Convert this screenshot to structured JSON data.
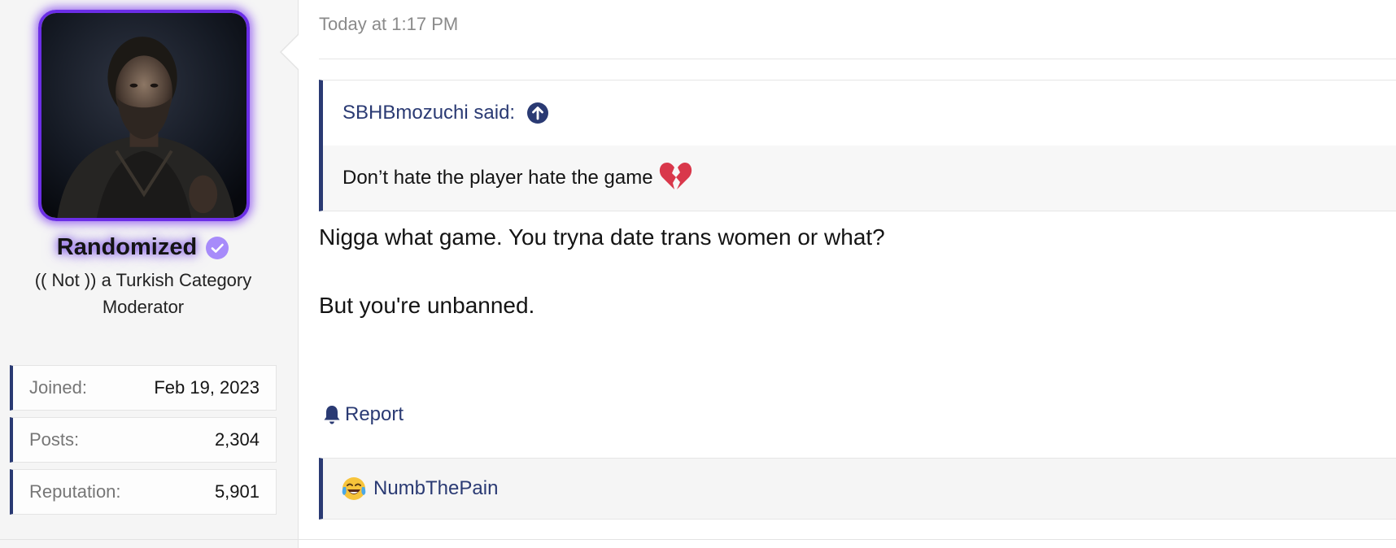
{
  "user": {
    "name": "Randomized",
    "title": "(( Not )) a Turkish Category Moderator",
    "stats": [
      {
        "label": "Joined:",
        "value": "Feb 19, 2023"
      },
      {
        "label": "Posts:",
        "value": "2,304"
      },
      {
        "label": "Reputation:",
        "value": "5,901"
      }
    ]
  },
  "post": {
    "timestamp": "Today at 1:17 PM",
    "quote": {
      "author_label": "SBHBmozuchi said:",
      "text": "Don’t hate the player hate the game"
    },
    "lines": [
      "Nigga what game. You tryna date trans women or what?",
      "But you're unbanned."
    ],
    "report_label": "Report",
    "reaction_user": "NumbThePain"
  },
  "colors": {
    "accent": "#2a3a73",
    "avatar_glow": "#7c3aed",
    "verified_badge": "#a78bfa"
  },
  "icons": [
    "verified-badge-icon",
    "arrow-up-circle-icon",
    "broken-heart-icon",
    "bell-icon",
    "laughing-crying-icon"
  ]
}
